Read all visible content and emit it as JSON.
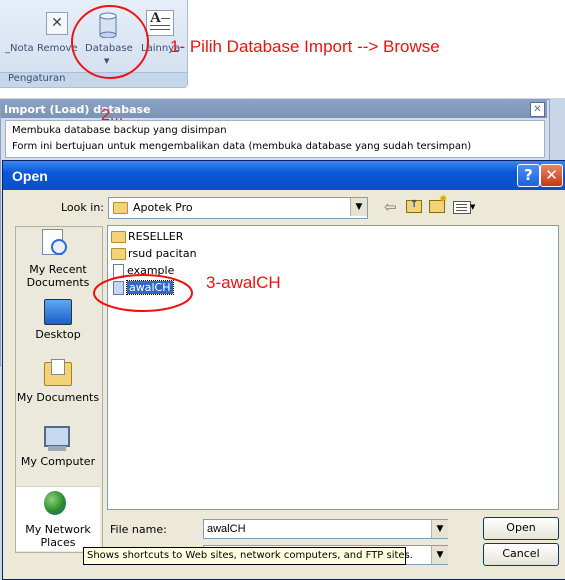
{
  "ribbon": {
    "buttons": [
      {
        "label": "_Nota",
        "icon": "nota-icon"
      },
      {
        "label": "Remove",
        "icon": "remove-icon"
      },
      {
        "label": "Database",
        "icon": "database-icon"
      },
      {
        "label": "Lainnya",
        "icon": "lainnya-icon"
      }
    ],
    "group_label": "Pengaturan"
  },
  "annotations": {
    "step1": "1- Pilih Database Import --> Browse",
    "step2": "2...",
    "step3": "3-awalCH"
  },
  "import_panel": {
    "title": "Import (Load) database",
    "line1": "Membuka database backup yang disimpan",
    "line2": "Form ini bertujuan untuk mengembalikan data (membuka database yang sudah tersimpan)",
    "close": "✕"
  },
  "dialog": {
    "title": "Open",
    "help_button": "?",
    "close_button": "✕",
    "look_in_label": "Look in:",
    "look_in_value": "Apotek Pro",
    "places": [
      {
        "label": "My Recent Documents",
        "icon": "recent-documents-icon"
      },
      {
        "label": "Desktop",
        "icon": "desktop-icon"
      },
      {
        "label": "My Documents",
        "icon": "my-documents-icon"
      },
      {
        "label": "My Computer",
        "icon": "my-computer-icon"
      },
      {
        "label": "My Network Places",
        "icon": "network-places-icon"
      }
    ],
    "files": [
      {
        "name": "RESELLER",
        "type": "folder"
      },
      {
        "name": "rsud pacitan",
        "type": "folder"
      },
      {
        "name": "example",
        "type": "file"
      },
      {
        "name": "awalCH",
        "type": "file",
        "selected": true
      }
    ],
    "file_name_label": "File name:",
    "file_name_value": "awalCH",
    "open_button": "Open",
    "cancel_button": "Cancel",
    "tooltip": "Shows shortcuts to Web sites, network computers, and FTP sites."
  },
  "colors": {
    "annotation": "#e11111",
    "title_bar": "#0b58d8",
    "selection": "#316ac5"
  }
}
